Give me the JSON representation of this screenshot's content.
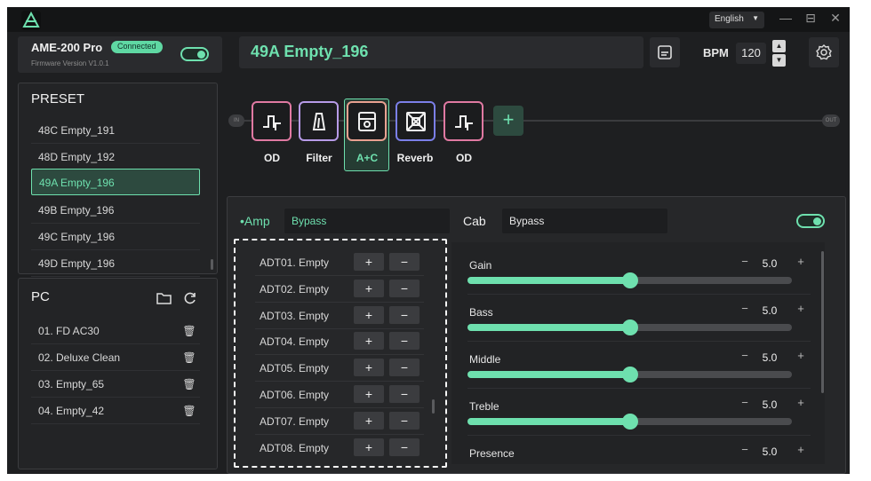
{
  "app": {
    "language": "English",
    "device_name": "AME-200 Pro",
    "connection_status": "Connected",
    "firmware": "Firmware Version V1.0.1",
    "preset_name": "49A  Empty_196",
    "bpm_label": "BPM",
    "bpm_value": "120"
  },
  "preset_panel": {
    "title": "PRESET",
    "items": [
      "48C  Empty_191",
      "48D  Empty_192",
      "49A  Empty_196",
      "49B  Empty_196",
      "49C  Empty_196",
      "49D  Empty_196"
    ],
    "selected_index": 2
  },
  "pc_panel": {
    "title": "PC",
    "items": [
      "01. FD AC30",
      "02. Deluxe Clean",
      "03. Empty_65",
      "04. Empty_42"
    ]
  },
  "chain": {
    "in_label": "IN",
    "out_label": "OUT",
    "blocks": [
      {
        "label": "OD",
        "icon": "od-icon",
        "color": "#e079a2"
      },
      {
        "label": "Filter",
        "icon": "filter-icon",
        "color": "#b79be8"
      },
      {
        "label": "A+C",
        "icon": "amp-cab-icon",
        "color": "#e8a090"
      },
      {
        "label": "Reverb",
        "icon": "reverb-icon",
        "color": "#7b7fe8"
      },
      {
        "label": "OD",
        "icon": "od-icon",
        "color": "#e079a2"
      }
    ],
    "selected_index": 2,
    "add_label": "+"
  },
  "amp": {
    "label": "•Amp",
    "model": "Bypass",
    "adt_items": [
      "ADT01. Empty",
      "ADT02. Empty",
      "ADT03. Empty",
      "ADT04. Empty",
      "ADT05. Empty",
      "ADT06. Empty",
      "ADT07. Empty",
      "ADT08. Empty"
    ],
    "plus_label": "+",
    "minus_label": "−"
  },
  "cab": {
    "label": "Cab",
    "model": "Bypass",
    "enabled": true
  },
  "params": [
    {
      "name": "Gain",
      "value": "5.0",
      "level": 0.5
    },
    {
      "name": "Bass",
      "value": "5.0",
      "level": 0.5
    },
    {
      "name": "Middle",
      "value": "5.0",
      "level": 0.5
    },
    {
      "name": "Treble",
      "value": "5.0",
      "level": 0.5
    },
    {
      "name": "Presence",
      "value": "5.0",
      "level": 0.5
    }
  ],
  "colors": {
    "accent": "#6ee0ae",
    "background": "#1e1f21"
  }
}
